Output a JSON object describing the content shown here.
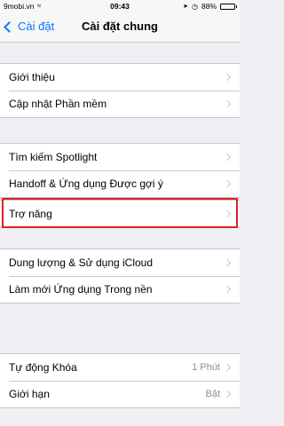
{
  "status_bar": {
    "carrier": "9mobi.vn",
    "time": "09:43",
    "battery_percent_text": "88%",
    "battery_level": 0.88
  },
  "nav": {
    "back_label": "Cài đặt",
    "title": "Cài đặt chung"
  },
  "groups": [
    {
      "items": [
        {
          "label": "Giới thiệu"
        },
        {
          "label": "Cập nhật Phần mềm"
        }
      ]
    },
    {
      "items": [
        {
          "label": "Tìm kiếm Spotlight"
        },
        {
          "label": "Handoff & Ứng dụng Được gợi ý"
        }
      ]
    },
    {
      "items": [
        {
          "label": "Trợ năng"
        }
      ]
    },
    {
      "items": [
        {
          "label": "Dung lượng & Sử dụng iCloud"
        },
        {
          "label": "Làm mới Ứng dụng Trong nền"
        }
      ]
    },
    {
      "items": [
        {
          "label": "Tự động Khóa",
          "value": "1 Phút"
        },
        {
          "label": "Giới hạn",
          "value": "Bật"
        }
      ]
    }
  ],
  "colors": {
    "accent": "#007aff",
    "highlight": "#e0202a",
    "background": "#efeff4"
  }
}
